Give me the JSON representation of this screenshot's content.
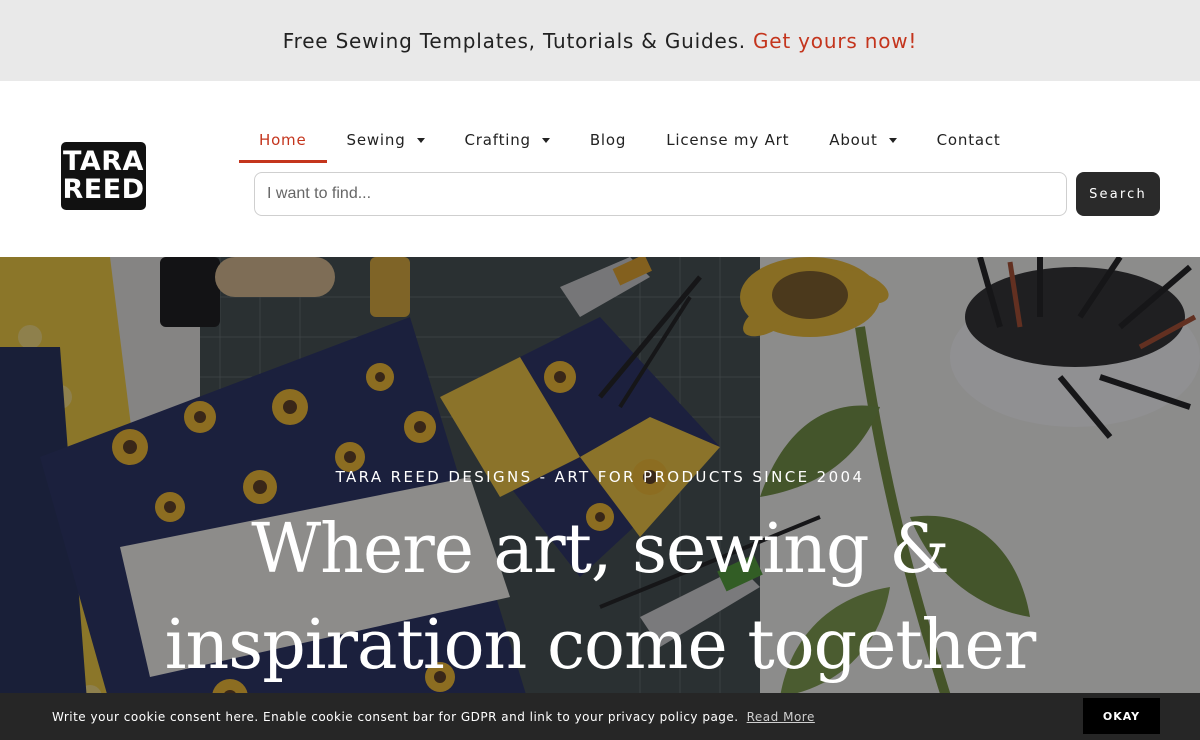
{
  "promo": {
    "text": "Free Sewing Templates, Tutorials & Guides.",
    "cta": "Get yours now!"
  },
  "logo": {
    "line1": "TARA",
    "line2": "REED"
  },
  "nav": {
    "items": [
      {
        "label": "Home",
        "active": true
      },
      {
        "label": "Sewing",
        "dropdown": true
      },
      {
        "label": "Crafting",
        "dropdown": true
      },
      {
        "label": "Blog"
      },
      {
        "label": "License my Art"
      },
      {
        "label": "About",
        "dropdown": true
      },
      {
        "label": "Contact"
      }
    ]
  },
  "search": {
    "placeholder": "I want to find...",
    "value": "",
    "button_label": "Search"
  },
  "hero": {
    "kicker": "TARA REED DESIGNS - ART FOR PRODUCTS SINCE 2004",
    "title_line1": "Where art, sewing &",
    "title_line2": "inspiration come together"
  },
  "cookie": {
    "text": "Write your cookie consent here. Enable cookie consent bar for GDPR and link to your privacy policy page.",
    "link": "Read More",
    "button": "OKAY"
  },
  "colors": {
    "accent": "#c4351d",
    "promo_bg": "#e9e9e9",
    "button_dark": "#2a2a2a",
    "cookie_bg": "#262626"
  }
}
